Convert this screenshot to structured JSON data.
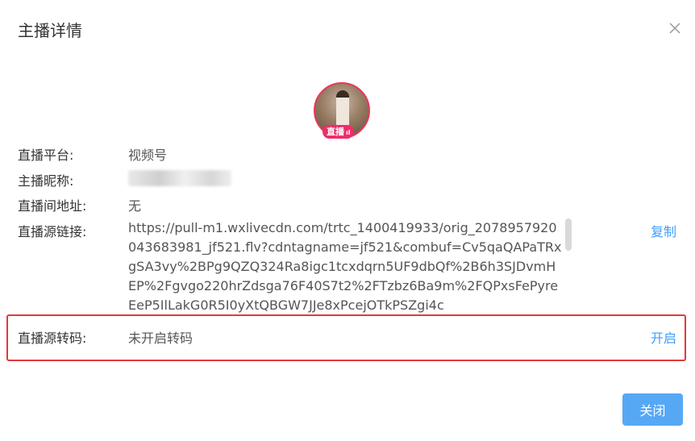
{
  "dialog": {
    "title": "主播详情",
    "close_icon": "close-icon"
  },
  "avatar": {
    "badge_label": "直播",
    "badge_icon": "live-bars-icon",
    "ring_color": "#e8375a",
    "badge_color": "#ef2d6a"
  },
  "fields": {
    "platform": {
      "label": "直播平台:",
      "value": "视频号"
    },
    "nickname": {
      "label": "主播昵称:"
    },
    "room_address": {
      "label": "直播间地址:",
      "value": "无"
    },
    "source_link": {
      "label": "直播源链接:",
      "value": "https://pull-m1.wxlivecdn.com/trtc_1400419933/orig_2078957920043683981_jf521.flv?cdntagname=jf521&combuf=Cv5qaQAPaTRxgSA3vy%2BPg9QZQ324Ra8igc1tcxdqrn5UF9dbQf%2B6h3SJDvmHEP%2Fgvgo220hrZdsga76F40S7t2%2FTzbz6Ba9m%2FQPxsFePyreEeP5IlLakG0R5I0yXtQBGW7JJe8xPcejOTkPSZgi4c",
      "action": "复制"
    },
    "transcode": {
      "label": "直播源转码:",
      "value": "未开启转码",
      "action": "开启"
    }
  },
  "footer": {
    "close_button": "关闭"
  },
  "colors": {
    "accent": "#409eff",
    "highlight_border": "#e5383b",
    "button_bg": "#56a8f5"
  }
}
